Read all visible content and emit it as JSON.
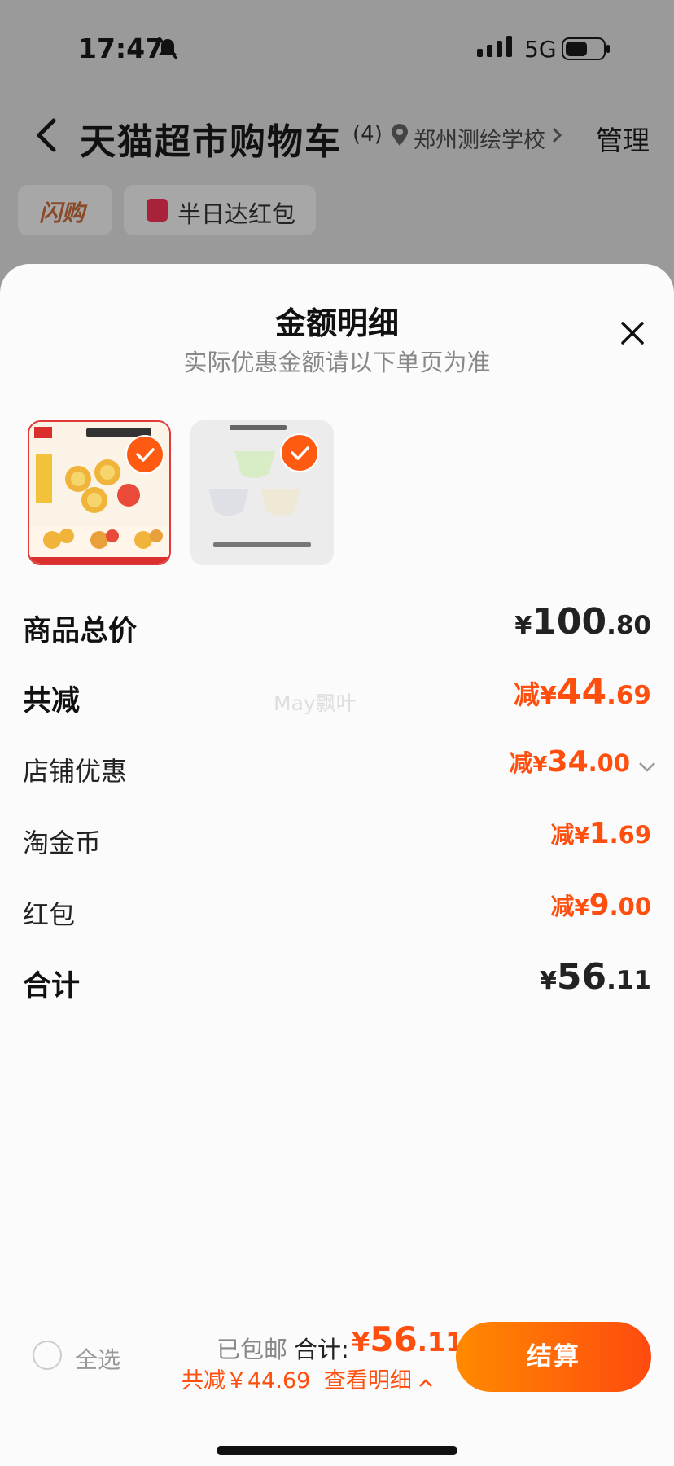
{
  "status_bar": {
    "time": "17:47",
    "network": "5G"
  },
  "nav": {
    "title": "天猫超市购物车",
    "count": "(4)",
    "location": "郑州测绘学校",
    "manage": "管理"
  },
  "chips": {
    "flash": "闪购",
    "red_packet": "半日达红包"
  },
  "sheet": {
    "title": "金额明细",
    "subtitle": "实际优惠金额请以下单页为准",
    "watermark": "May飘叶",
    "rows": {
      "total_price": {
        "label": "商品总价",
        "yen": "¥",
        "int": "100",
        "dec": ".80"
      },
      "total_discount": {
        "label": "共减",
        "prefix": "减",
        "yen": "¥",
        "int": "44",
        "dec": ".69"
      },
      "store_discount": {
        "label": "店铺优惠",
        "prefix": "减",
        "yen": "¥",
        "int": "34",
        "dec": ".00"
      },
      "coins": {
        "label": "淘金币",
        "prefix": "减",
        "yen": "¥",
        "int": "1",
        "dec": ".69"
      },
      "red_packet": {
        "label": "红包",
        "prefix": "减",
        "yen": "¥",
        "int": "9",
        "dec": ".00"
      },
      "sum": {
        "label": "合计",
        "yen": "¥",
        "int": "56",
        "dec": ".11"
      }
    }
  },
  "bottom_bar": {
    "select_all": "全选",
    "shipped": "已包邮",
    "total_label": "合计:",
    "total_yen": "¥",
    "total_int": "56",
    "total_dec": ".11",
    "discount_text": "共减￥44.69",
    "detail_link": "查看明细",
    "checkout": "结算"
  },
  "colors": {
    "accent": "#ff4f0f",
    "checkout_start": "#ff8a00",
    "checkout_end": "#ff4a0f"
  },
  "icons": [
    "back-arrow-icon",
    "location-pin-icon",
    "chevron-right-icon",
    "close-icon",
    "checkmark-icon",
    "chevron-down-icon",
    "chevron-up-icon",
    "bell-muted-icon",
    "signal-icon",
    "battery-icon"
  ]
}
